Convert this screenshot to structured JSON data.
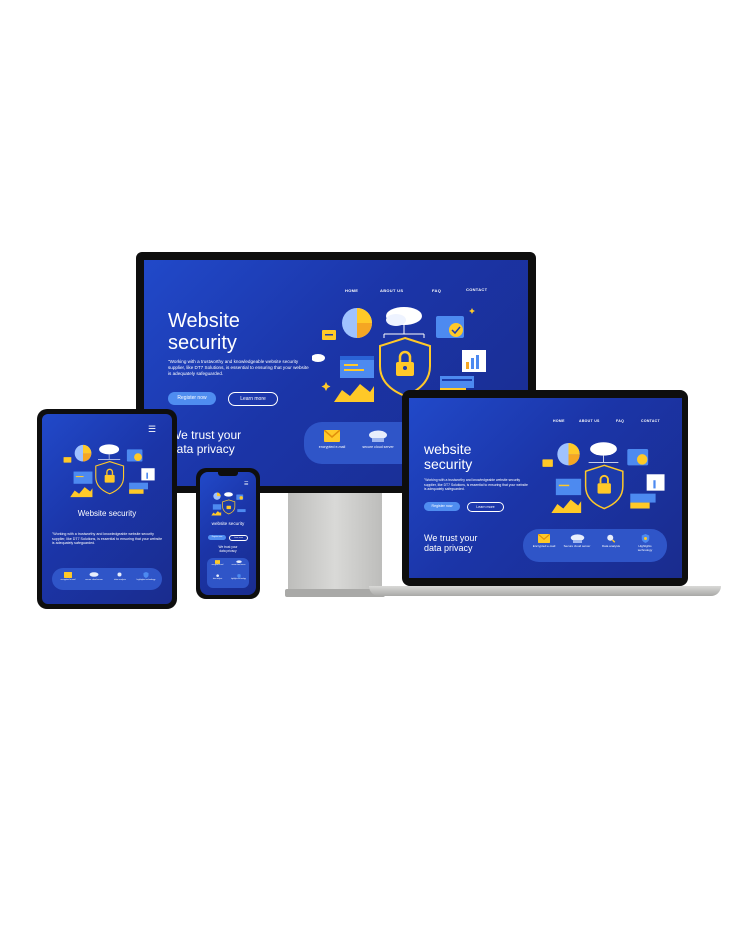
{
  "desktop": {
    "nav": [
      "HOME",
      "ABOUT US",
      "FAQ",
      "CONTACT"
    ],
    "title_line1": "Website",
    "title_line2": "security",
    "desc": "\"Working with a trustworthy and knowledgeable website security supplier, like DT7 Solutions, is essential to ensuring that your website is adequately safeguarded.",
    "register": "Register now",
    "learn": "Learn more",
    "trust_line1": "We trust your",
    "trust_line2": "data privacy",
    "features": [
      "encrypted e-mail",
      "secure cloud server"
    ]
  },
  "laptop": {
    "nav": [
      "HOME",
      "ABOUT US",
      "FAQ",
      "CONTACT"
    ],
    "title_line1": "website",
    "title_line2": "security",
    "desc": "\"Working with a trustworthy and knowledgeable website security supplier, like DT7 Solutions, is essential to ensuring that your website is adequately safeguarded.",
    "register": "Register now",
    "learn": "Learn more",
    "trust_line1": "We trust your",
    "trust_line2": "data privacy",
    "features": [
      "Encrypted e-mail",
      "Secure cloud server",
      "Data analysis",
      "Highlights technology"
    ]
  },
  "tablet": {
    "menu_icon": "hamburger-icon",
    "title": "Website security",
    "desc": "\"Working with a trustworthy and knowledgeable website security supplier, like DT7 Solutions, is essential to ensuring that your website is adequately safeguarded.",
    "features": [
      "encrypted e-mail",
      "secure cloud server",
      "data analysis",
      "highlights technology"
    ]
  },
  "phone": {
    "title": "website security",
    "register": "Register now",
    "learn": "Learn more",
    "trust_line1": "We trust your",
    "trust_line2": "data privacy",
    "features": [
      "encrypted e-mail",
      "secure cloud server",
      "data analysis",
      "highlights technology"
    ]
  },
  "colors": {
    "screen_blue": "#1f3fb8",
    "accent_orange": "#f5a623",
    "accent_yellow": "#ffc928",
    "button_blue": "#4f8df0",
    "bezel": "#111111",
    "stand_gray": "#c8c8c6"
  }
}
